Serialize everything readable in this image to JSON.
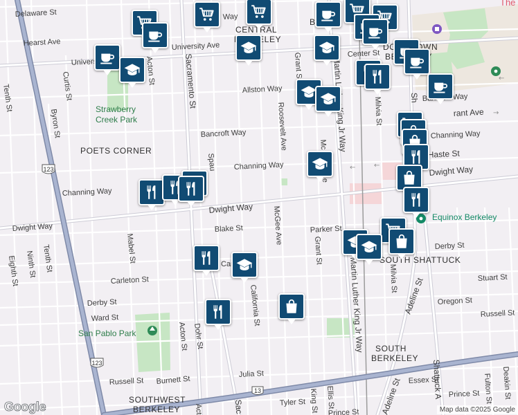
{
  "map": {
    "attribution": "Map data ©2025 Google",
    "logo": "Google",
    "corner_link": "The",
    "colors": {
      "background": "#f2eff3",
      "street": "#ffffff",
      "arterial": "#cfcfd8",
      "highway": "#9aa5c4",
      "highway_casing": "#7f8aa8",
      "park": "#c7e6c4",
      "campus": "#ede7df",
      "pin": "#114b73",
      "railway": "#8a8a8a"
    },
    "labels": {
      "delaware": "Delaware St",
      "hearst": "Hearst Ave",
      "university1": "University Ave",
      "university2": "Universi",
      "university3": "Way",
      "central_berkeley_1": "CENTRAL",
      "central_berkeley_2": "BERKELEY",
      "berkeley_top": "Be",
      "downtown_1": "DOWNTOWN",
      "downtown_2": "BERKELEY",
      "center_st": "Center St",
      "allston": "Allston Way",
      "bancroft": "Bancroft Way",
      "bancroft_right": "Bancroft Way",
      "durant": "Durant Ave",
      "channing_left": "Channing Way",
      "channing_mid": "Channing Way",
      "channing_right": "Channing Way",
      "haste": "Haste St",
      "dwight_left": "Dwight Way",
      "dwight_mid": "Dwight Way",
      "dwight_right": "Dwight Way",
      "blake": "Blake St",
      "parker": "Parker St",
      "derby_left": "Derby St",
      "derby_right": "Derby St",
      "carleton": "Carleton St",
      "carleton_short": "Car",
      "stuart": "Stuart St",
      "oregon": "Oregon St",
      "russell_right": "Russell St",
      "russell_left": "Russell St",
      "ward": "Ward St",
      "julia": "Julia St",
      "burnett": "Burnett St",
      "tyler": "Tyler St",
      "essex": "Essex St",
      "prince_left": "Prince St",
      "prince_right": "Prince St",
      "curtis": "Curtis St",
      "tenth": "Tenth St",
      "tenth_b": "Tenth St",
      "ninth": "Ninth St",
      "eighth": "Eighth St",
      "byron": "Byron St",
      "acton_top": "Acton St",
      "acton_bottom": "Acton St",
      "sacramento": "Sacramento St",
      "spaulding": "Spau",
      "mabel": "Mabel St",
      "dohr": "Dohr St",
      "california": "California St",
      "roosevelt": "Roosevelt Ave",
      "mcgee": "McGee Ave",
      "grant_top": "Grant St",
      "grant_mid": "Grant St",
      "mlk_top": "Martin Luther King Jr Way",
      "mlk_bottom": "Martin Luther King Jr Way",
      "mckinley_top": "Mc",
      "mckinley_bottom": "e",
      "milvia_top": "Milvia St",
      "milvia_bottom": "Milvia St",
      "shattuck_top": "Sh",
      "shattuck_bottom": "Shattuck A",
      "adeline_top": "Adeline St",
      "adeline_bottom": "Adeline St",
      "fulton": "Fulton St",
      "deakin": "Deakin St",
      "ellis": "Ellis St",
      "king": "King St",
      "sac_bottom": "Sac",
      "act_bottom": "Act",
      "route_123_a": "123",
      "route_123_b": "123",
      "route_13": "13",
      "poets_corner": "POETS CORNER",
      "south_shattuck": "SOUTH SHATTUCK",
      "south_berkeley_1": "SOUTH",
      "south_berkeley_2": "BERKELEY",
      "southwest_berkeley_1": "SOUTHWEST",
      "southwest_berkeley_2": "BERKELEY",
      "strawberry_1": "Strawberry",
      "strawberry_2": "Creek Park",
      "san_pablo_park": "San Pablo Park",
      "equinox": "Equinox Berkeley",
      "grant_ave_right": "rant Ave"
    },
    "markers": [
      {
        "name": "cafe",
        "icon": "cafe-icon"
      },
      {
        "name": "grocery",
        "icon": "grocery-icon"
      },
      {
        "name": "restaurant",
        "icon": "restaurant-icon"
      },
      {
        "name": "school",
        "icon": "school-icon"
      },
      {
        "name": "store",
        "icon": "shopping-bag-icon"
      }
    ]
  }
}
